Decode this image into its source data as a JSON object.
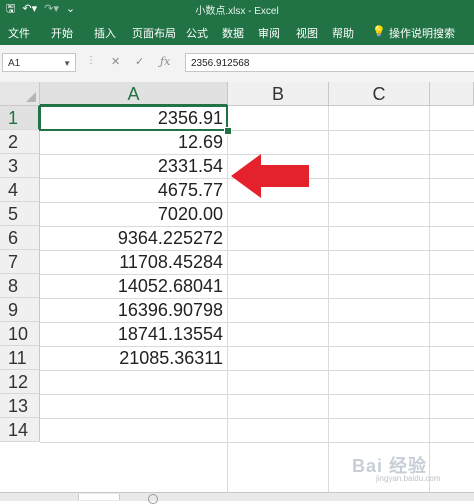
{
  "app": {
    "title": "小数点.xlsx  -  Excel",
    "accent": "#217346"
  },
  "ribbon": {
    "tabs": [
      "文件",
      "开始",
      "插入",
      "页面布局",
      "公式",
      "数据",
      "审阅",
      "视图",
      "帮助",
      "操作说明搜索"
    ]
  },
  "formula_bar": {
    "name_box": "A1",
    "content": "2356.912568"
  },
  "sheet": {
    "columns": [
      "A",
      "B",
      "C"
    ],
    "rows": [
      "1",
      "2",
      "3",
      "4",
      "5",
      "6",
      "7",
      "8",
      "9",
      "10",
      "11",
      "12",
      "13",
      "14"
    ],
    "column_a_values": [
      "2356.91",
      "12.69",
      "2331.54",
      "4675.77",
      "7020.00",
      "9364.225272",
      "11708.45284",
      "14052.68041",
      "16396.90798",
      "18741.13554",
      "21085.36311"
    ]
  },
  "annotation": {
    "arrow_color": "#e5222b",
    "points_to_row": "3"
  },
  "watermark": {
    "text": "Bai 经验",
    "sub": "jingyan.baidu.com"
  }
}
